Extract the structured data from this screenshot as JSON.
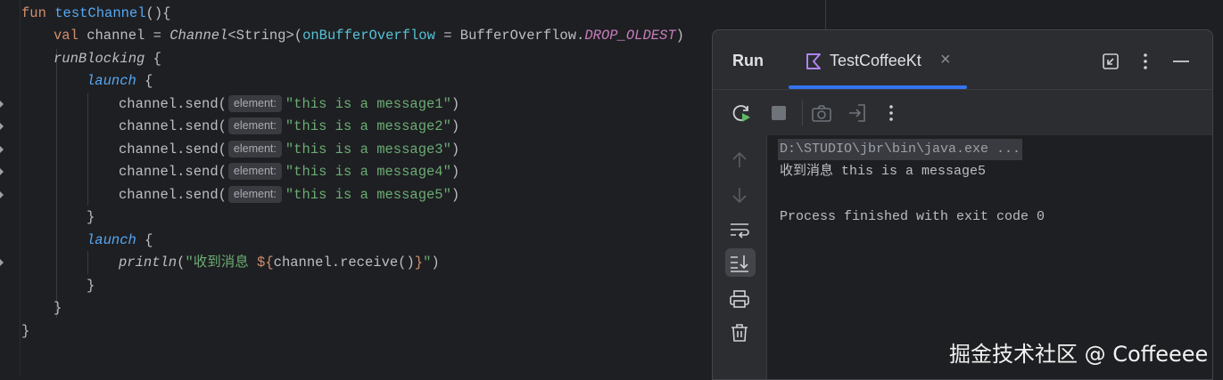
{
  "editor": {
    "lines": {
      "l1": {
        "kw": "fun",
        "name": "testChannel",
        "rest": "(){"
      },
      "l2": {
        "kw": "val",
        "var": " channel = ",
        "cls": "Channel",
        "type": "<String>(",
        "param": "onBufferOverflow",
        "eq": " = BufferOverflow.",
        "const": "DROP_OLDEST",
        "close": ")"
      },
      "l3": {
        "fn": "runBlocking",
        "rest": " {"
      },
      "l4": {
        "fn": "launch",
        "rest": " {"
      },
      "send": [
        {
          "call": "channel.send(",
          "hint": "element:",
          "str": "\"this is a message1\"",
          "close": ")"
        },
        {
          "call": "channel.send(",
          "hint": "element:",
          "str": "\"this is a message2\"",
          "close": ")"
        },
        {
          "call": "channel.send(",
          "hint": "element:",
          "str": "\"this is a message3\"",
          "close": ")"
        },
        {
          "call": "channel.send(",
          "hint": "element:",
          "str": "\"this is a message4\"",
          "close": ")"
        },
        {
          "call": "channel.send(",
          "hint": "element:",
          "str": "\"this is a message5\"",
          "close": ")"
        }
      ],
      "l10": "}",
      "l11": {
        "fn": "launch",
        "rest": " {"
      },
      "l12": {
        "fn": "println",
        "open": "(",
        "str1": "\"收到消息 ",
        "tmpl_open": "${",
        "expr": "channel.receive()",
        "tmpl_close": "}",
        "str2": "\"",
        "close": ")"
      },
      "l13": "}",
      "l14": "}",
      "l15": "}"
    }
  },
  "run_panel": {
    "title": "Run",
    "tab_label": "TestCoffeeKt",
    "tab_close": "×",
    "console": {
      "command": "D:\\STUDIO\\jbr\\bin\\java.exe ...",
      "output": "收到消息 this is a message5",
      "finished": "Process finished with exit code 0"
    }
  },
  "watermark": "掘金技术社区 @ Coffeeee",
  "colors": {
    "accent": "#3574f0",
    "run_green": "#5fb865",
    "keyword": "#cf8e6d",
    "function": "#56a8f5",
    "string": "#6aab73"
  }
}
